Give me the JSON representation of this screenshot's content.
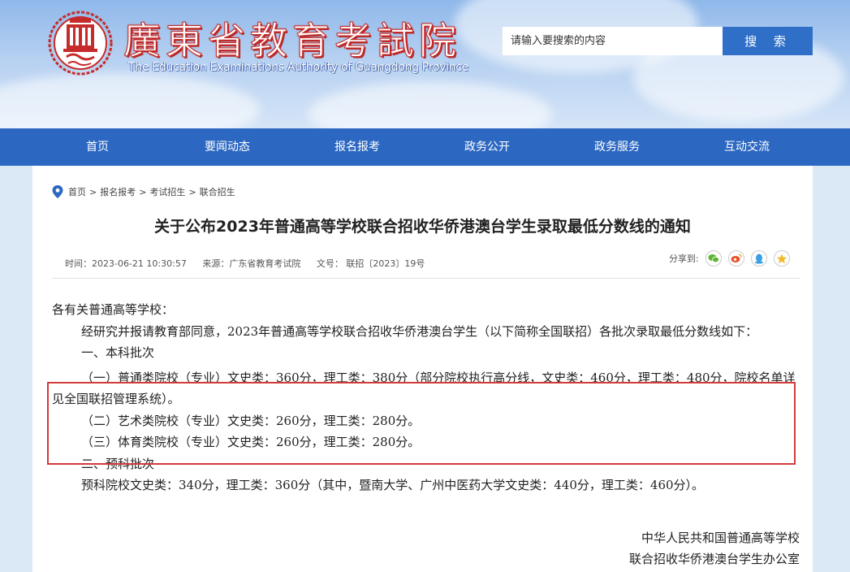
{
  "header": {
    "site_title": "廣東省教育考試院",
    "site_subtitle": "The Education Examinations Authority of Guangdong Province",
    "search_placeholder": "请输入要搜索的内容",
    "search_button": "搜 索"
  },
  "nav": {
    "items": [
      "首页",
      "要闻动态",
      "报名报考",
      "政务公开",
      "政务服务",
      "互动交流"
    ]
  },
  "breadcrumb": [
    "首页",
    "报名报考",
    "考试招生",
    "联合招生"
  ],
  "breadcrumb_sep": ">",
  "article": {
    "title": "关于公布2023年普通高等学校联合招收华侨港澳台学生录取最低分数线的通知",
    "time": "时间：2023-06-21 10:30:57",
    "source": "来源：广东省教育考试院",
    "doc_no": "文号：  联招〔2023〕19号",
    "share_label": "分享到:",
    "greeting": "各有关普通高等学校：",
    "intro": "经研究并报请教育部同意，2023年普通高等学校联合招收华侨港澳台学生（以下简称全国联招）各批次录取最低分数线如下：",
    "section1": "一、本科批次",
    "item1": "（一）普通类院校（专业）文史类：360分，理工类：380分（部分院校执行高分线，文史类：460分，理工类：480分，院校名单详见全国联招管理系统）。",
    "item2": "（二）艺术类院校（专业）文史类：260分，理工类：280分。",
    "item3": "（三）体育类院校（专业）文史类：260分，理工类：280分。",
    "section2": "二、预科批次",
    "prep": "预科院校文史类：340分，理工类：360分（其中，暨南大学、广州中医药大学文史类：440分，理工类：460分）。",
    "sign1": "中华人民共和国普通高等学校",
    "sign2": "联合招收华侨港澳台学生办公室"
  },
  "colors": {
    "nav_bg": "#2c68c2",
    "search_button_bg": "#2f6fc7",
    "title_red": "#c62b2b",
    "highlight_border": "#d23a3a",
    "share_wechat": "#5cb531",
    "share_weibo": "#e8552d",
    "share_qq": "#3aa0e6",
    "share_qzone": "#f2b92c"
  },
  "icons": {
    "logo": "building-seal-logo",
    "breadcrumb": "location-pin-icon",
    "share": [
      "wechat-icon",
      "weibo-icon",
      "qq-icon",
      "qzone-icon"
    ]
  }
}
